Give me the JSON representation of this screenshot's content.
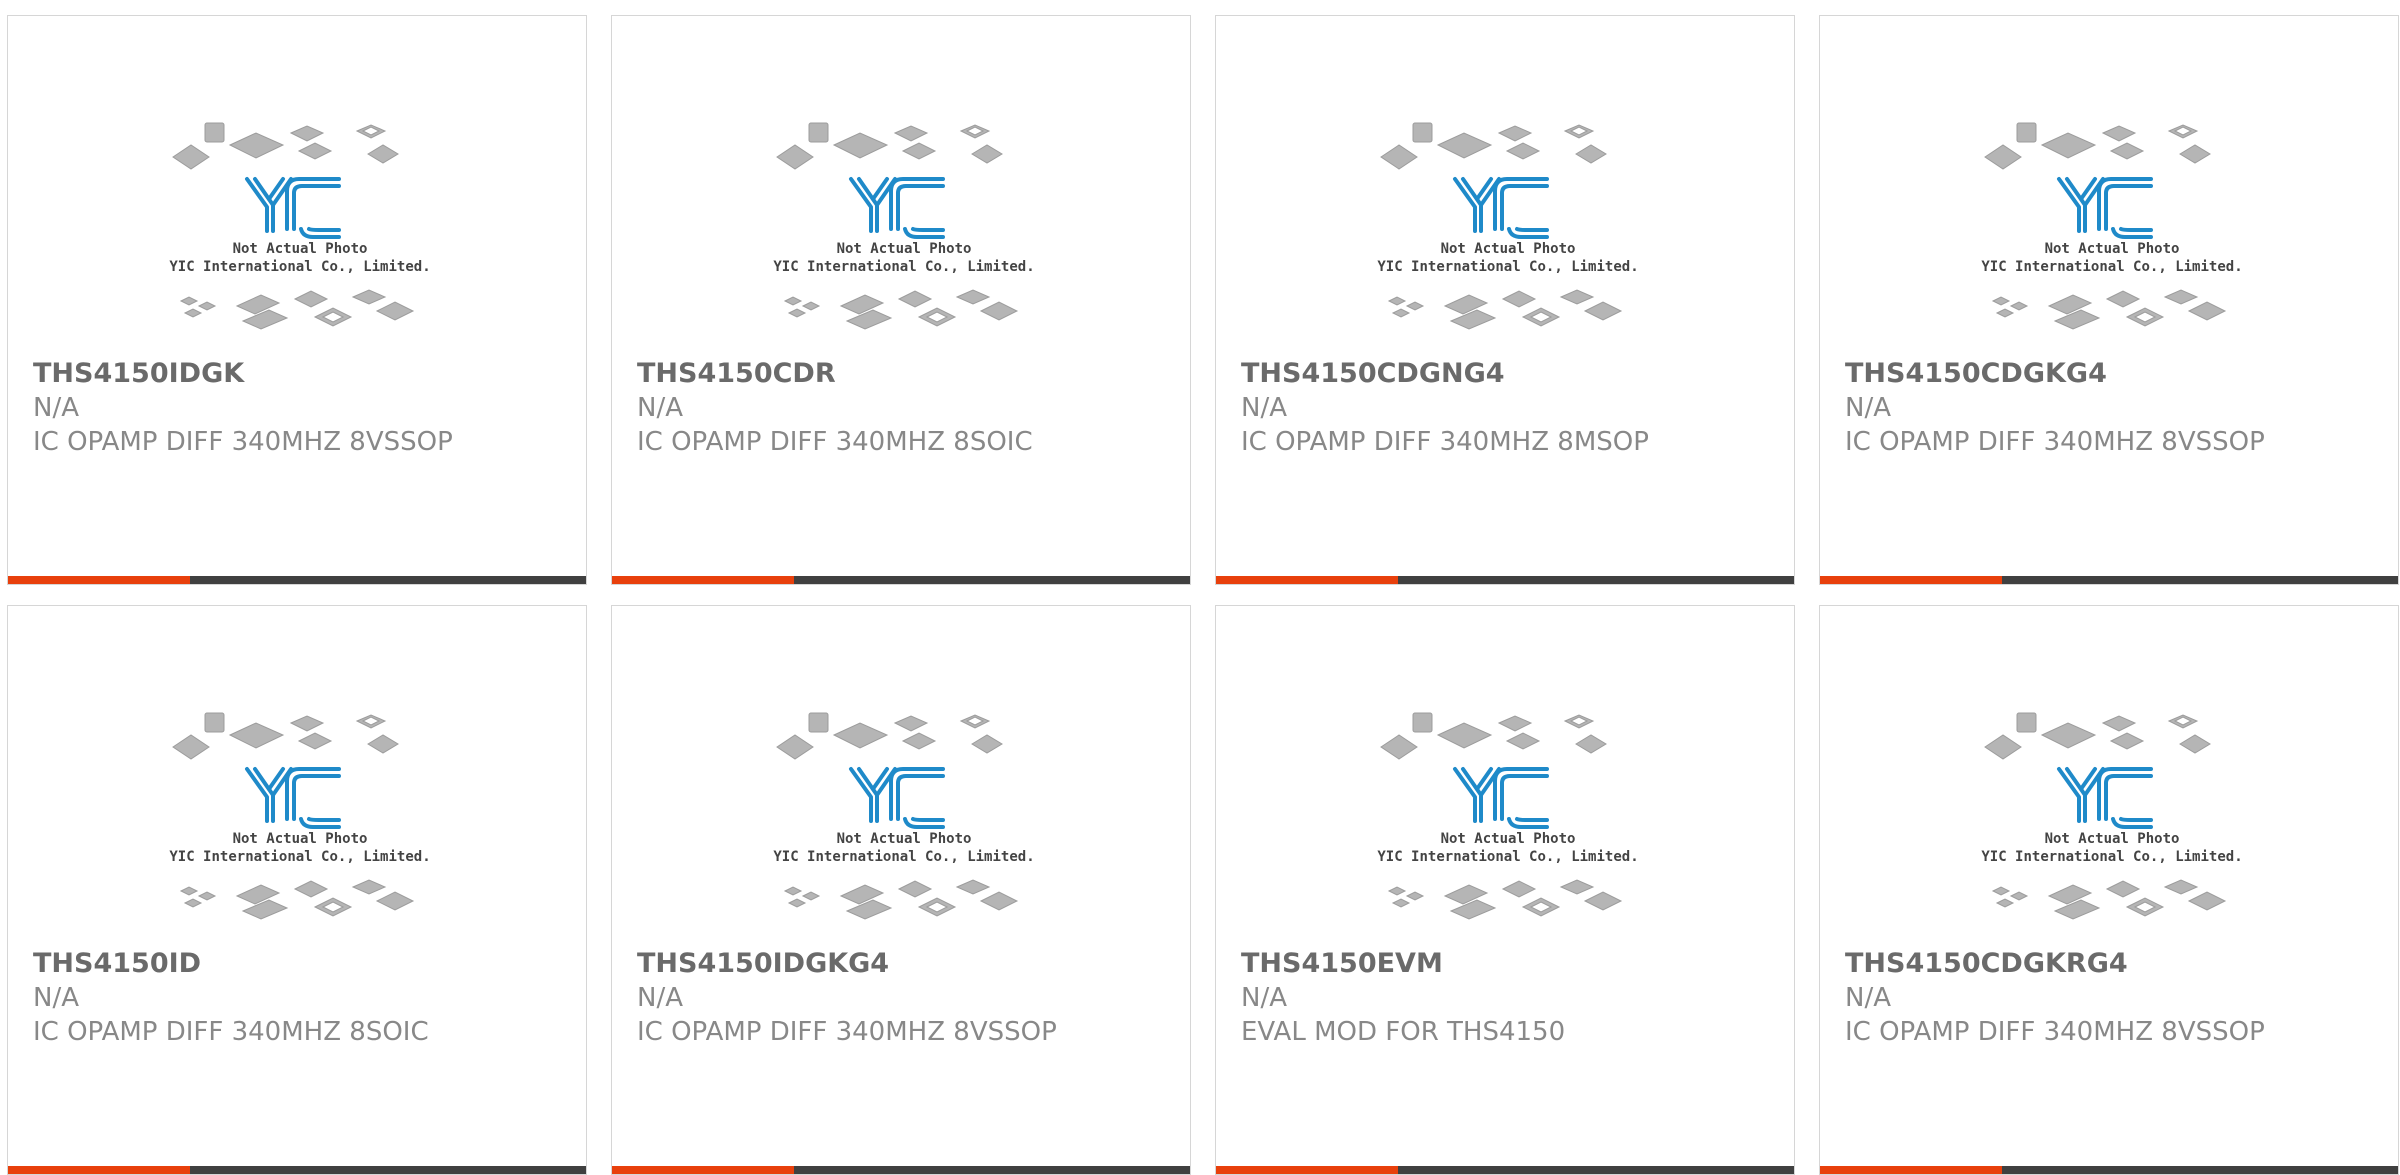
{
  "colors": {
    "accent": "#e8400c",
    "bar_dark": "#404040",
    "logo_blue": "#1f8ac9",
    "chip_gray": "#b5b5b5"
  },
  "placeholder_image": {
    "icon": "chip-packages-placeholder-icon",
    "logo_text": "YIC",
    "line1": "Not Actual Photo",
    "line2": "YIC International Co., Limited."
  },
  "products": [
    {
      "part_number": "THS4150IDGK",
      "manufacturer": "N/A",
      "description": "IC OPAMP DIFF 340MHZ 8VSSOP"
    },
    {
      "part_number": "THS4150CDR",
      "manufacturer": "N/A",
      "description": "IC OPAMP DIFF 340MHZ 8SOIC"
    },
    {
      "part_number": "THS4150CDGNG4",
      "manufacturer": "N/A",
      "description": "IC OPAMP DIFF 340MHZ 8MSOP"
    },
    {
      "part_number": "THS4150CDGKG4",
      "manufacturer": "N/A",
      "description": "IC OPAMP DIFF 340MHZ 8VSSOP"
    },
    {
      "part_number": "THS4150ID",
      "manufacturer": "N/A",
      "description": "IC OPAMP DIFF 340MHZ 8SOIC"
    },
    {
      "part_number": "THS4150IDGKG4",
      "manufacturer": "N/A",
      "description": "IC OPAMP DIFF 340MHZ 8VSSOP"
    },
    {
      "part_number": "THS4150EVM",
      "manufacturer": "N/A",
      "description": "EVAL MOD FOR THS4150"
    },
    {
      "part_number": "THS4150CDGKRG4",
      "manufacturer": "N/A",
      "description": "IC OPAMP DIFF 340MHZ 8VSSOP"
    }
  ]
}
